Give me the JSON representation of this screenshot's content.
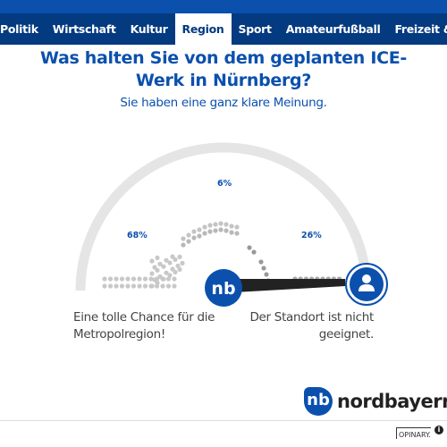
{
  "nav": {
    "items": [
      "Politik",
      "Wirtschaft",
      "Kultur",
      "Region",
      "Sport",
      "Amateurfußball",
      "Freizeit & Events"
    ],
    "active": "Region"
  },
  "poll": {
    "question": "Was halten Sie von dem geplanten ICE-Werk in Nürnberg?",
    "subtitle": "Sie haben eine ganz klare Meinung.",
    "left_label": "Eine tolle Chance für die Metropolregion!",
    "right_label": "Der Standort ist nicht geeignet.",
    "results": [
      {
        "value": "68%"
      },
      {
        "value": "6%"
      },
      {
        "value": "26%"
      }
    ],
    "center_icon": "nordbayern-nb-icon",
    "user_icon": "user-icon"
  },
  "brand": {
    "logo_mark": "nb",
    "logo_text": "nordbayern",
    "accent": "#0b50ad"
  },
  "footer": {
    "opinary": "OPINARY.",
    "info_icon": "i"
  }
}
